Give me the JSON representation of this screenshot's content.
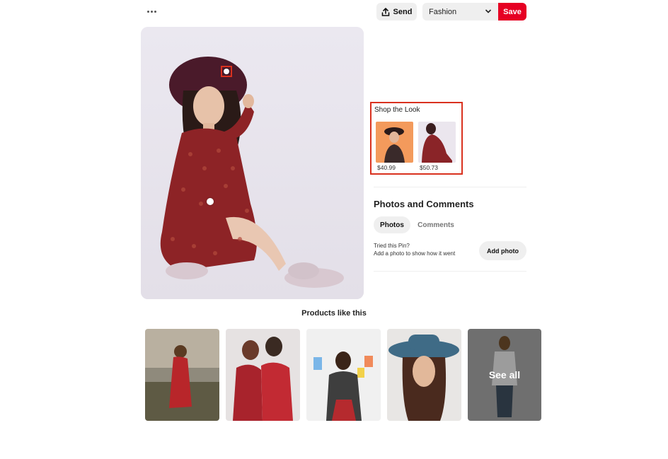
{
  "toolbar": {
    "more_icon": "ellipsis-icon",
    "send_label": "Send",
    "send_icon": "share-upload-icon",
    "board_value": "Fashion",
    "save_label": "Save",
    "save_color": "#e60023"
  },
  "shop_the_look": {
    "title": "Shop the Look",
    "items": [
      {
        "price": "$40.99"
      },
      {
        "price": "$50.73"
      }
    ],
    "highlight_color": "#d9311f"
  },
  "photos_comments": {
    "title": "Photos and Comments",
    "tabs": [
      {
        "label": "Photos",
        "active": true
      },
      {
        "label": "Comments",
        "active": false
      }
    ],
    "tried_line1": "Tried this Pin?",
    "tried_line2": "Add a photo to show how it went",
    "add_photo_label": "Add photo"
  },
  "products": {
    "title": "Products like this",
    "see_all_label": "See all"
  }
}
